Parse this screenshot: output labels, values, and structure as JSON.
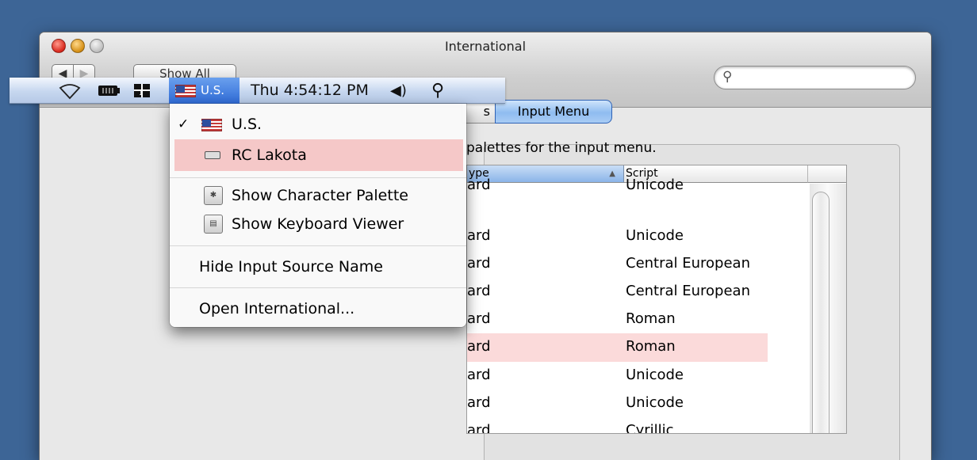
{
  "window": {
    "title": "International",
    "back_button": "◀",
    "forward_button": "▶",
    "show_all_button": "Show All",
    "search_placeholder": ""
  },
  "tabs": {
    "partial_tab_label": "s",
    "active_tab_label": "Input Menu"
  },
  "instruction": "palettes for the input menu.",
  "table": {
    "columns": [
      "ype",
      "Script",
      ""
    ],
    "rows": [
      {
        "type": "ard",
        "script": "Unicode",
        "selected": false
      },
      {
        "type": "ard",
        "script": "Unicode",
        "selected": false
      },
      {
        "type": "ard",
        "script": "Central European",
        "selected": false
      },
      {
        "type": "ard",
        "script": "Central European",
        "selected": false
      },
      {
        "type": "ard",
        "script": "Roman",
        "selected": false
      },
      {
        "type": "ard",
        "script": "Roman",
        "selected": true
      },
      {
        "type": "ard",
        "script": "Unicode",
        "selected": false
      },
      {
        "type": "ard",
        "script": "Unicode",
        "selected": false
      },
      {
        "type": "ard",
        "script": "Cyrillic",
        "selected": false
      }
    ]
  },
  "menubar": {
    "input_source_label": "U.S.",
    "clock": "Thu 4:54:12 PM",
    "volume_glyph": "◀)",
    "spotlight_glyph": "⚲"
  },
  "menu": {
    "checkmark": "✓",
    "items": [
      {
        "label": "U.S."
      },
      {
        "label": "RC Lakota"
      },
      {
        "label": "Show Character Palette"
      },
      {
        "label": "Show Keyboard Viewer"
      },
      {
        "label": "Hide Input Source Name"
      },
      {
        "label": "Open International..."
      }
    ]
  },
  "icons": {
    "window": [
      "close-icon",
      "minimize-icon",
      "zoom-icon",
      "search-icon"
    ],
    "menubar": [
      "wifi-icon",
      "battery-icon",
      "spaces-icon",
      "us-flag-icon",
      "volume-icon",
      "spotlight-icon"
    ],
    "menu": [
      "checkmark-icon",
      "us-flag-icon",
      "keyboard-icon",
      "character-palette-icon",
      "keyboard-viewer-icon"
    ]
  },
  "colors": {
    "desktop": "#3d6596",
    "selected_input_source": "#2f6bd6",
    "highlight_row": "#fbdada",
    "highlight_menu_item": "#f5c8c8",
    "active_tab": "#8fbcf0"
  }
}
